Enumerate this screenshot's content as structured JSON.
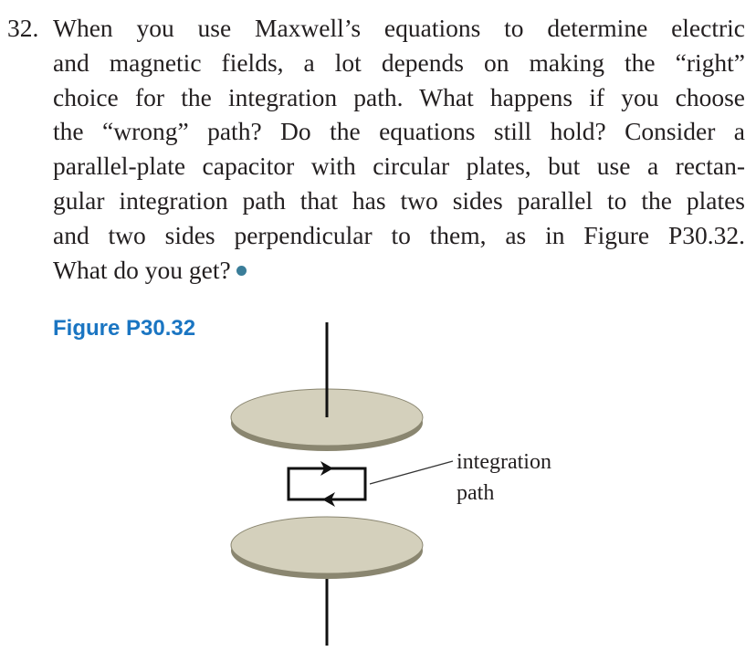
{
  "problem": {
    "number": "32.",
    "lines": [
      "When you use Maxwell’s equations to determine electric",
      "and magnetic fields, a lot depends on making the “right”",
      "choice for the integration path. What happens if you choose",
      "the “wrong” path? Do the equations still hold? Consider a",
      "parallel-plate capacitor with circular plates, but use a rectan-",
      "gular integration path that has two sides parallel to the plates",
      "and two sides perpendicular to them, as in Figure P30.32.",
      "What do you get?"
    ],
    "marker_icon": "bullet-dot",
    "marker_color": "#3a7d99"
  },
  "figure": {
    "label": "Figure P30.32",
    "label_color": "#1a75c2",
    "callout_line1": "integration",
    "callout_line2": "path",
    "plate_color": "#d4d0bc",
    "plate_edge_color": "#8a8670"
  }
}
